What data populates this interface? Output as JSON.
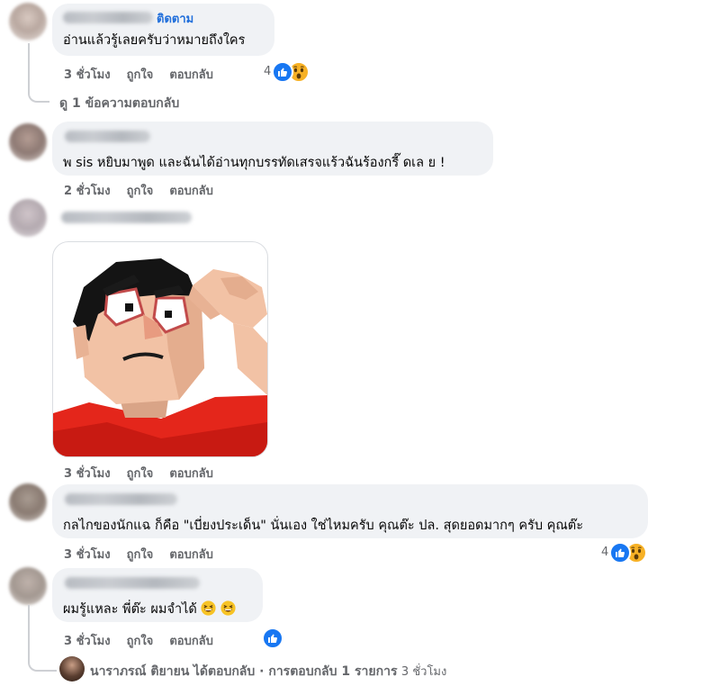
{
  "comments": [
    {
      "follow_label": "ติดตาม",
      "text": "อ่านแล้วรู้เลยครับว่าหมายถึงใคร",
      "time": "3 ชั่วโมง",
      "like": "ถูกใจ",
      "reply": "ตอบกลับ",
      "reaction_count": "4",
      "view_replies": "ดู 1 ข้อความตอบกลับ"
    },
    {
      "text": "พ sis หยิบมาพูด และฉันได้อ่านทุกบรรทัดเสรจแร้วฉันร้องกรี๊ ดเล ย !",
      "time": "2 ชั่วโมง",
      "like": "ถูกใจ",
      "reply": "ตอบกลับ"
    },
    {
      "time": "3 ชั่วโมง",
      "like": "ถูกใจ",
      "reply": "ตอบกลับ"
    },
    {
      "text": "กลไกของนักแฉ ก็คือ \"เบี่ยงประเด็น\" นั่นเอง ใช่ไหมครับ คุณต๊ะ ปล. สุดยอดมากๆ ครับ คุณต๊ะ",
      "time": "3 ชั่วโมง",
      "like": "ถูกใจ",
      "reply": "ตอบกลับ",
      "reaction_count": "4"
    },
    {
      "text": "ผมรู้แหละ พี่ต๊ะ ผมจำได้",
      "time": "3 ชั่วโมง",
      "like": "ถูกใจ",
      "reply": "ตอบกลับ",
      "reply_summary": {
        "author": "นาราภรณ์ ติยายน",
        "action": "ได้ตอบกลับ · การตอบกลับ 1 รายการ",
        "time": "3 ชั่วโมง"
      }
    }
  ],
  "colors": {
    "bubble": "#f0f2f5",
    "meta": "#65676b",
    "follow": "#216fdb",
    "like_icon": "#1877f2",
    "wow_icon": "#f7b125"
  },
  "icons": [
    "like-reaction-icon",
    "wow-reaction-icon",
    "grinning-squint-emoji"
  ]
}
